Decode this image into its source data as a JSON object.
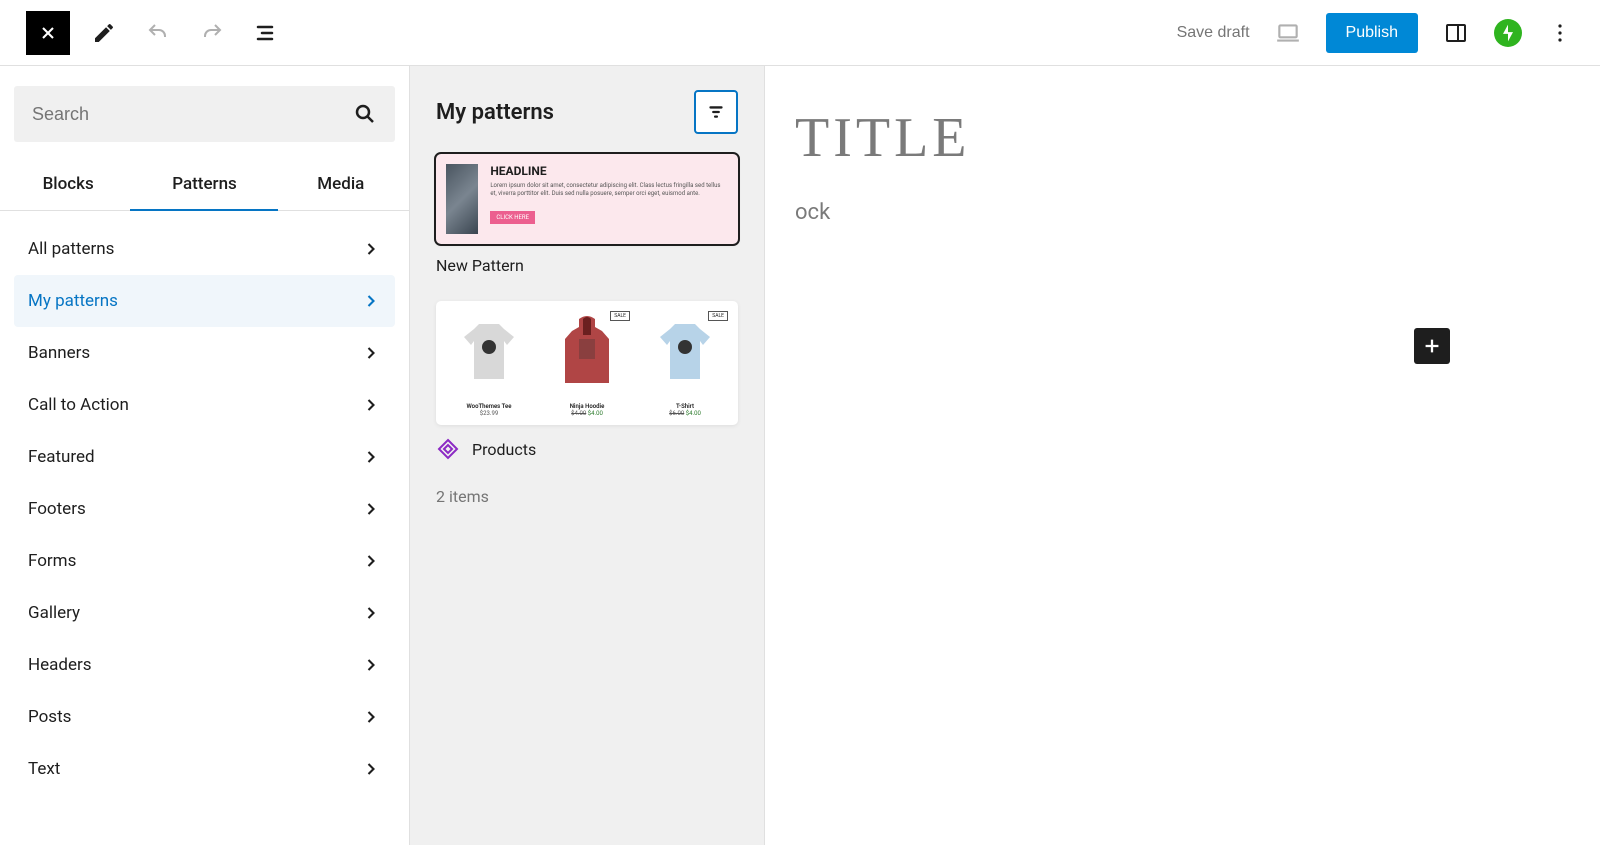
{
  "toolbar": {
    "save_draft": "Save draft",
    "publish": "Publish"
  },
  "search": {
    "placeholder": "Search"
  },
  "tabs": {
    "blocks": "Blocks",
    "patterns": "Patterns",
    "media": "Media",
    "active": "Patterns"
  },
  "categories": [
    {
      "label": "All patterns",
      "active": false
    },
    {
      "label": "My patterns",
      "active": true
    },
    {
      "label": "Banners",
      "active": false
    },
    {
      "label": "Call to Action",
      "active": false
    },
    {
      "label": "Featured",
      "active": false
    },
    {
      "label": "Footers",
      "active": false
    },
    {
      "label": "Forms",
      "active": false
    },
    {
      "label": "Gallery",
      "active": false
    },
    {
      "label": "Headers",
      "active": false
    },
    {
      "label": "Posts",
      "active": false
    },
    {
      "label": "Text",
      "active": false
    }
  ],
  "panel": {
    "title": "My patterns",
    "patterns": [
      {
        "label": "New Pattern",
        "selected": true,
        "headline": "HEADLINE",
        "body": "Lorem ipsum dolor sit amet, consectetur adipiscing elit. Class lectus fringilla sed tellus et, viverra porttitor elit. Duis sed nulla posuere, semper orci eget, euismod ante.",
        "button": "CLICK HERE"
      },
      {
        "label": "Products",
        "synced": true,
        "products": [
          {
            "name": "WooThemes Tee",
            "price": "$23.99",
            "sale": false
          },
          {
            "name": "Ninja Hoodie",
            "old_price": "$4.00",
            "price": "$4.00",
            "sale": true
          },
          {
            "name": "T-Shirt",
            "old_price": "$6.00",
            "price": "$4.00",
            "sale": true
          }
        ],
        "sale_label": "SALE"
      }
    ],
    "count": "2 items"
  },
  "canvas": {
    "title_placeholder": "TITLE",
    "block_placeholder": "ock"
  }
}
